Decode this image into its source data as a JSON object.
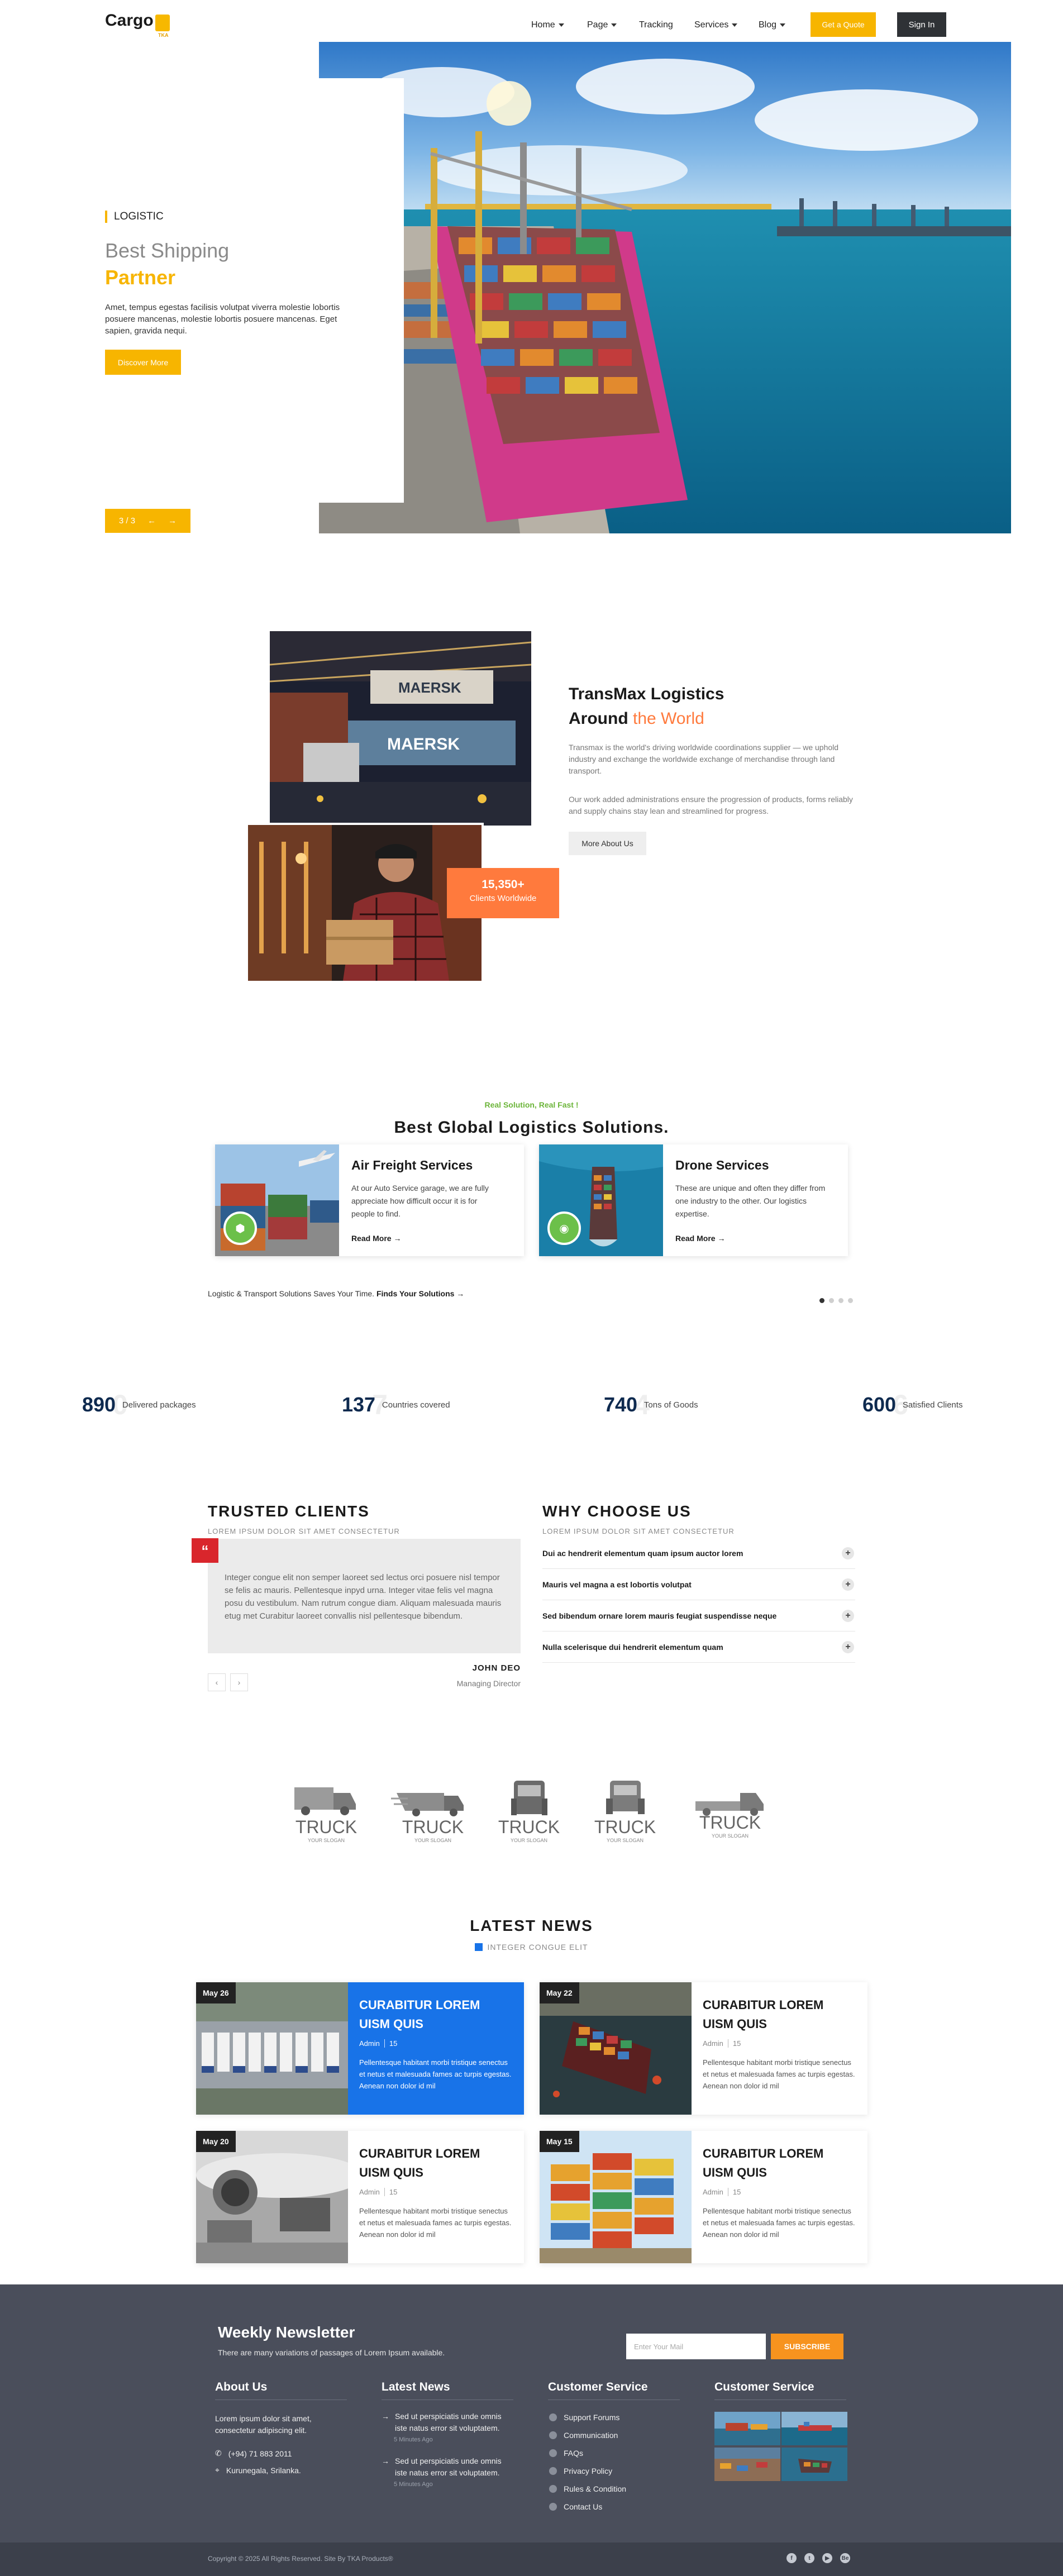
{
  "header": {
    "logo": "Cargo",
    "logo_sub": "TKA",
    "nav": [
      {
        "label": "Home",
        "dropdown": true
      },
      {
        "label": "Page",
        "dropdown": true
      },
      {
        "label": "Tracking",
        "dropdown": false
      },
      {
        "label": "Services",
        "dropdown": true
      },
      {
        "label": "Blog",
        "dropdown": true
      }
    ],
    "quote_label": "Get a Quote",
    "signin_label": "Sign In"
  },
  "hero": {
    "tag": "LOGISTIC",
    "title_line1": "Best Shipping",
    "title_line2": "Partner",
    "description": "Amet, tempus egestas facilisis volutpat viverra molestie lobortis posuere mancenas, molestie lobortis posuere mancenas. Eget sapien, gravida nequi.",
    "cta_label": "Discover More",
    "slide_counter": "3 / 3",
    "prev_icon": "arrow-left-icon",
    "next_icon": "arrow-right-icon"
  },
  "about": {
    "title_line1": "TransMax Logistics",
    "title_line2_plain": "Around ",
    "title_line2_accent": "the World",
    "para1": "Transmax is the world's driving worldwide coordinations supplier — we uphold industry and exchange the worldwide exchange of merchandise through land transport.",
    "para2": "Our work added administrations ensure the progression of products, forms reliably and supply chains stay lean and streamlined for progress.",
    "badge_number": "15,350+",
    "badge_label": "Clients Worldwide",
    "button_label": "More About Us"
  },
  "services": {
    "kicker": "Real Solution, Real Fast !",
    "title": "Best Global Logistics Solutions.",
    "cards": [
      {
        "title": "Air Freight Services",
        "text": "At our Auto Service garage, we are fully appreciate how difficult occur it is for people to find.",
        "more": "Read More",
        "icon": "box-icon"
      },
      {
        "title": "Drone Services",
        "text": "These are unique and often they differ from one industry to the other. Our logistics expertise.",
        "more": "Read More",
        "icon": "map-pin-icon"
      }
    ],
    "footer_text": "Logistic & Transport Solutions Saves Your Time.",
    "footer_link": "Finds Your Solutions →"
  },
  "stats": [
    {
      "value": "890",
      "ghost": "0",
      "label": "Delivered packages"
    },
    {
      "value": "137",
      "ghost": "7",
      "label": "Countries covered"
    },
    {
      "value": "740",
      "ghost": "4",
      "label": "Tons of Goods"
    },
    {
      "value": "600",
      "ghost": "6",
      "label": "Satisfied Clients"
    }
  ],
  "clients": {
    "title": "TRUSTED CLIENTS",
    "subtitle": "LOREM IPSUM DOLOR SIT AMET CONSECTETUR",
    "quote_mark": "“",
    "quote": "Integer congue elit non semper laoreet sed lectus orci posuere nisl tempor se felis ac mauris. Pellentesque inpyd urna. Integer vitae felis vel magna posu du vestibulum. Nam rutrum congue diam. Aliquam malesuada mauris etug met Curabitur laoreet convallis nisl pellentesque bibendum.",
    "author": "JOHN DEO",
    "role": "Managing Director",
    "prev": "‹",
    "next": "›"
  },
  "why": {
    "title": "WHY CHOOSE US",
    "subtitle": "LOREM IPSUM DOLOR SIT AMET CONSECTETUR",
    "items": [
      "Dui ac hendrerit elementum quam ipsum auctor lorem",
      "Mauris vel magna a est lobortis volutpat",
      "Sed bibendum ornare lorem mauris feugiat suspendisse neque",
      "Nulla scelerisque dui hendrerit elementum quam"
    ],
    "toggle": "+"
  },
  "partners": [
    {
      "word": "TRUCK",
      "slogan": "YOUR SLOGAN"
    },
    {
      "word": "TRUCK",
      "slogan": "YOUR SLOGAN"
    },
    {
      "word": "TRUCK",
      "slogan": "YOUR SLOGAN"
    },
    {
      "word": "TRUCK",
      "slogan": "YOUR SLOGAN"
    },
    {
      "word": "TRUCK",
      "slogan": "YOUR SLOGAN"
    }
  ],
  "news": {
    "title": "LATEST NEWS",
    "subtitle": "INTEGER CONGUE ELIT",
    "items": [
      {
        "date": "May 26",
        "title": "CURABITUR LOREM UISM QUIS",
        "author": "Admin",
        "count": "15",
        "excerpt": "Pellentesque habitant morbi tristique senectus et netus et malesuada fames ac turpis egestas. Aenean non dolor id mil"
      },
      {
        "date": "May 22",
        "title": "CURABITUR LOREM UISM QUIS",
        "author": "Admin",
        "count": "15",
        "excerpt": "Pellentesque habitant morbi tristique senectus et netus et malesuada fames ac turpis egestas. Aenean non dolor id mil"
      },
      {
        "date": "May 20",
        "title": "CURABITUR LOREM UISM QUIS",
        "author": "Admin",
        "count": "15",
        "excerpt": "Pellentesque habitant morbi tristique senectus et netus et malesuada fames ac turpis egestas. Aenean non dolor id mil"
      },
      {
        "date": "May 15",
        "title": "CURABITUR LOREM UISM QUIS",
        "author": "Admin",
        "count": "15",
        "excerpt": "Pellentesque habitant morbi tristique senectus et netus et malesuada fames ac turpis egestas. Aenean non dolor id mil"
      }
    ]
  },
  "footer": {
    "newsletter_title": "Weekly Newsletter",
    "newsletter_text": "There are many variations of passages of Lorem Ipsum available.",
    "email_placeholder": "Enter Your Mail",
    "subscribe_label": "SUBSCRIBE",
    "about_title": "About Us",
    "about_text": "Lorem ipsum dolor sit amet, consectetur adipiscing elit.",
    "phone": "(+94) 71 883 2011",
    "address": "Kurunegala, Srilanka.",
    "latest_title": "Latest News",
    "latest": [
      {
        "text": "Sed ut perspiciatis unde omnis iste natus error sit voluptatem.",
        "time": "5 Minutes Ago"
      },
      {
        "text": "Sed ut perspiciatis unde omnis iste natus error sit voluptatem.",
        "time": "5 Minutes Ago"
      }
    ],
    "service_title": "Customer Service",
    "service_links": [
      "Support Forums",
      "Communication",
      "FAQs",
      "Privacy Policy",
      "Rules & Condition",
      "Contact Us"
    ],
    "gallery_title": "Customer Service",
    "copyright": "Copyright © 2025 All Rights Reserved. Site By TKA Products®",
    "social": [
      "f",
      "t",
      "▶",
      "Be"
    ]
  },
  "colors": {
    "brand_yellow": "#f7b500",
    "accent_orange": "#ff7a3d",
    "green": "#6cc04a",
    "blue": "#1873e8",
    "navy": "#0e2a4f",
    "footer_bg": "#4a4e5b"
  }
}
